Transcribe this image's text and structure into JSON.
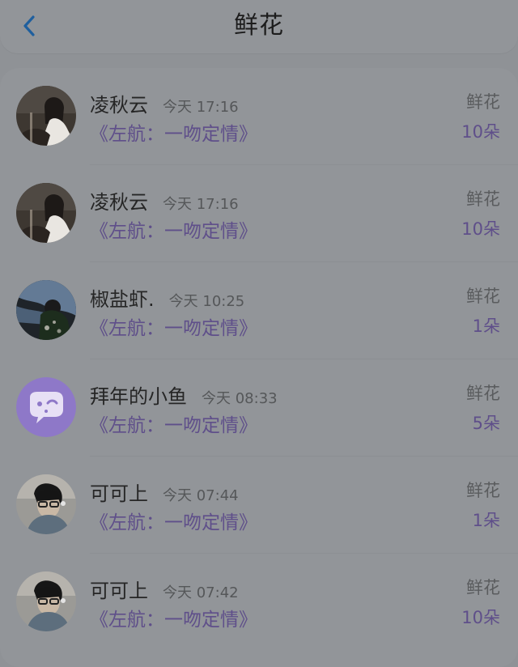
{
  "header": {
    "title": "鲜花",
    "back_icon": "chevron-left-icon",
    "accent": "#1f5f9e"
  },
  "list": {
    "items": [
      {
        "user": "凌秋云",
        "time": "今天 17:16",
        "book": "《左航：一吻定情》",
        "gift": "鲜花",
        "count": "10朵",
        "avatar": "photo-avatar-girl"
      },
      {
        "user": "凌秋云",
        "time": "今天 17:16",
        "book": "《左航：一吻定情》",
        "gift": "鲜花",
        "count": "10朵",
        "avatar": "photo-avatar-girl"
      },
      {
        "user": "椒盐虾.",
        "time": "今天 10:25",
        "book": "《左航：一吻定情》",
        "gift": "鲜花",
        "count": "1朵",
        "avatar": "photo-avatar-night"
      },
      {
        "user": "拜年的小鱼",
        "time": "今天 08:33",
        "book": "《左航：一吻定情》",
        "gift": "鲜花",
        "count": "5朵",
        "avatar": "chat-bubble-avatar"
      },
      {
        "user": "可可上",
        "time": "今天 07:44",
        "book": "《左航：一吻定情》",
        "gift": "鲜花",
        "count": "1朵",
        "avatar": "photo-avatar-boy"
      },
      {
        "user": "可可上",
        "time": "今天 07:42",
        "book": "《左航：一吻定情》",
        "gift": "鲜花",
        "count": "10朵",
        "avatar": "photo-avatar-boy"
      }
    ]
  },
  "colors": {
    "background": "#8f9296",
    "card": "#929599",
    "purple": "#5f4f8a",
    "avatar_purple": "#8e78c8"
  }
}
